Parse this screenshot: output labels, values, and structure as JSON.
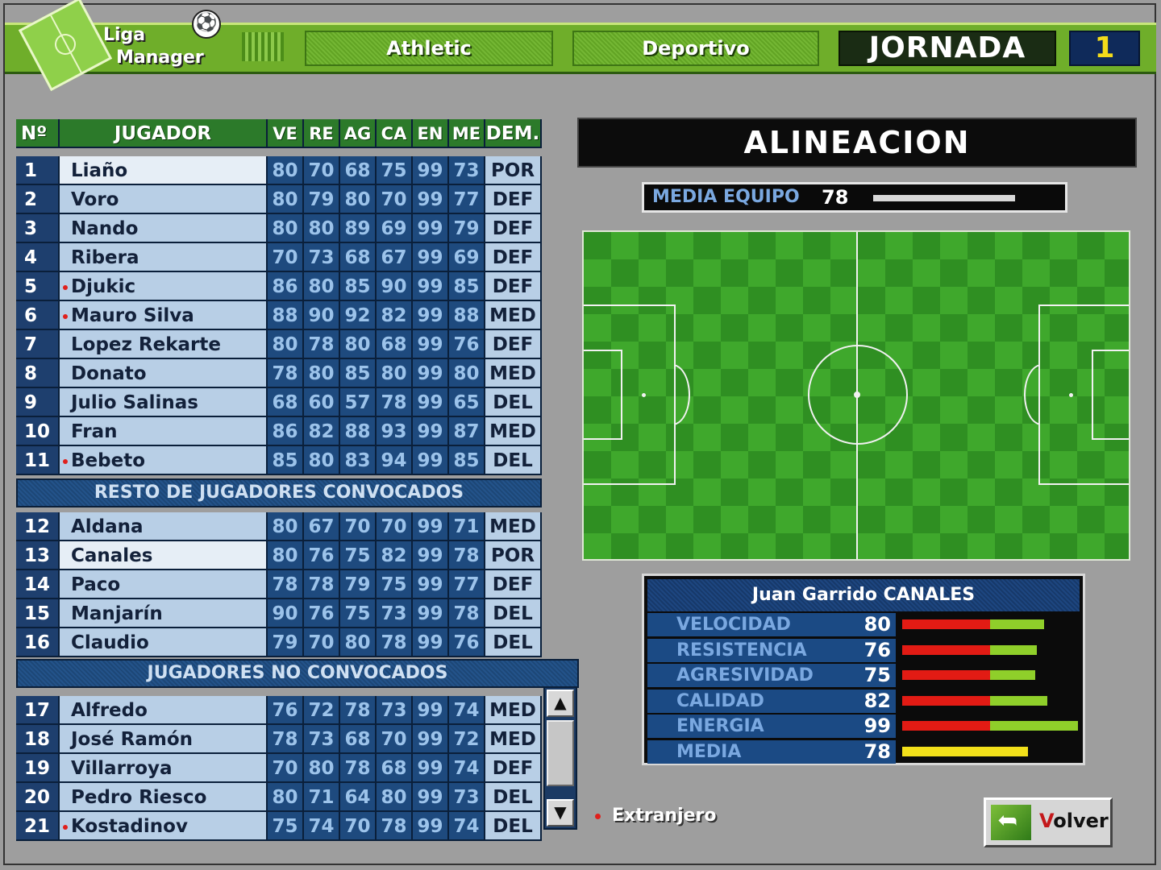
{
  "header": {
    "logo_line1": "Liga",
    "logo_line2": "Manager",
    "home_team": "Athletic",
    "away_team": "Deportivo",
    "jornada_label": "JORNADA",
    "jornada_number": "1"
  },
  "table": {
    "columns": [
      "Nº",
      "JUGADOR",
      "VE",
      "RE",
      "AG",
      "CA",
      "EN",
      "ME",
      "DEM."
    ],
    "starters": [
      {
        "num": "1",
        "name": "Liaño",
        "foreign": false,
        "highlight": true,
        "stats": [
          "80",
          "70",
          "68",
          "75",
          "99",
          "73"
        ],
        "pos": "POR"
      },
      {
        "num": "2",
        "name": "Voro",
        "foreign": false,
        "highlight": false,
        "stats": [
          "80",
          "79",
          "80",
          "70",
          "99",
          "77"
        ],
        "pos": "DEF"
      },
      {
        "num": "3",
        "name": "Nando",
        "foreign": false,
        "highlight": false,
        "stats": [
          "80",
          "80",
          "89",
          "69",
          "99",
          "79"
        ],
        "pos": "DEF"
      },
      {
        "num": "4",
        "name": "Ribera",
        "foreign": false,
        "highlight": false,
        "stats": [
          "70",
          "73",
          "68",
          "67",
          "99",
          "69"
        ],
        "pos": "DEF"
      },
      {
        "num": "5",
        "name": "Djukic",
        "foreign": true,
        "highlight": false,
        "stats": [
          "86",
          "80",
          "85",
          "90",
          "99",
          "85"
        ],
        "pos": "DEF"
      },
      {
        "num": "6",
        "name": "Mauro Silva",
        "foreign": true,
        "highlight": false,
        "stats": [
          "88",
          "90",
          "92",
          "82",
          "99",
          "88"
        ],
        "pos": "MED"
      },
      {
        "num": "7",
        "name": "Lopez Rekarte",
        "foreign": false,
        "highlight": false,
        "stats": [
          "80",
          "78",
          "80",
          "68",
          "99",
          "76"
        ],
        "pos": "DEF"
      },
      {
        "num": "8",
        "name": "Donato",
        "foreign": false,
        "highlight": false,
        "stats": [
          "78",
          "80",
          "85",
          "80",
          "99",
          "80"
        ],
        "pos": "MED"
      },
      {
        "num": "9",
        "name": "Julio Salinas",
        "foreign": false,
        "highlight": false,
        "stats": [
          "68",
          "60",
          "57",
          "78",
          "99",
          "65"
        ],
        "pos": "DEL"
      },
      {
        "num": "10",
        "name": "Fran",
        "foreign": false,
        "highlight": false,
        "stats": [
          "86",
          "82",
          "88",
          "93",
          "99",
          "87"
        ],
        "pos": "MED"
      },
      {
        "num": "11",
        "name": "Bebeto",
        "foreign": true,
        "highlight": false,
        "stats": [
          "85",
          "80",
          "83",
          "94",
          "99",
          "85"
        ],
        "pos": "DEL"
      }
    ],
    "convocados_title": "RESTO DE JUGADORES CONVOCADOS",
    "convocados": [
      {
        "num": "12",
        "name": "Aldana",
        "foreign": false,
        "highlight": false,
        "stats": [
          "80",
          "67",
          "70",
          "70",
          "99",
          "71"
        ],
        "pos": "MED"
      },
      {
        "num": "13",
        "name": "Canales",
        "foreign": false,
        "highlight": true,
        "stats": [
          "80",
          "76",
          "75",
          "82",
          "99",
          "78"
        ],
        "pos": "POR"
      },
      {
        "num": "14",
        "name": "Paco",
        "foreign": false,
        "highlight": false,
        "stats": [
          "78",
          "78",
          "79",
          "75",
          "99",
          "77"
        ],
        "pos": "DEF"
      },
      {
        "num": "15",
        "name": "Manjarín",
        "foreign": false,
        "highlight": false,
        "stats": [
          "90",
          "76",
          "75",
          "73",
          "99",
          "78"
        ],
        "pos": "DEL"
      },
      {
        "num": "16",
        "name": "Claudio",
        "foreign": false,
        "highlight": false,
        "stats": [
          "79",
          "70",
          "80",
          "78",
          "99",
          "76"
        ],
        "pos": "DEL"
      }
    ],
    "no_convocados_title": "JUGADORES NO CONVOCADOS",
    "no_convocados": [
      {
        "num": "17",
        "name": "Alfredo",
        "foreign": false,
        "highlight": false,
        "stats": [
          "76",
          "72",
          "78",
          "73",
          "99",
          "74"
        ],
        "pos": "MED"
      },
      {
        "num": "18",
        "name": "José Ramón",
        "foreign": false,
        "highlight": false,
        "stats": [
          "78",
          "73",
          "68",
          "70",
          "99",
          "72"
        ],
        "pos": "MED"
      },
      {
        "num": "19",
        "name": "Villarroya",
        "foreign": false,
        "highlight": false,
        "stats": [
          "70",
          "80",
          "78",
          "68",
          "99",
          "74"
        ],
        "pos": "DEF"
      },
      {
        "num": "20",
        "name": "Pedro Riesco",
        "foreign": false,
        "highlight": false,
        "stats": [
          "80",
          "71",
          "64",
          "80",
          "99",
          "73"
        ],
        "pos": "DEL"
      },
      {
        "num": "21",
        "name": "Kostadinov",
        "foreign": true,
        "highlight": false,
        "stats": [
          "75",
          "74",
          "70",
          "78",
          "99",
          "74"
        ],
        "pos": "DEL"
      }
    ]
  },
  "legend": {
    "foreign_label": "Extranjero"
  },
  "alineacion": {
    "title": "ALINEACION",
    "media_equipo_label": "MEDIA EQUIPO",
    "media_equipo_value": "78",
    "media_equipo_fraction": 0.78
  },
  "player_detail": {
    "name": "Juan Garrido CANALES",
    "attributes": [
      {
        "label": "VELOCIDAD",
        "value": "80",
        "red_fraction": 0.55,
        "total_fraction": 0.8,
        "color": "red-green"
      },
      {
        "label": "RESISTENCIA",
        "value": "76",
        "red_fraction": 0.55,
        "total_fraction": 0.76,
        "color": "red-green"
      },
      {
        "label": "AGRESIVIDAD",
        "value": "75",
        "red_fraction": 0.55,
        "total_fraction": 0.75,
        "color": "red-green"
      },
      {
        "label": "CALIDAD",
        "value": "82",
        "red_fraction": 0.55,
        "total_fraction": 0.82,
        "color": "red-green"
      },
      {
        "label": "ENERGIA",
        "value": "99",
        "red_fraction": 0.55,
        "total_fraction": 0.99,
        "color": "red-green"
      },
      {
        "label": "MEDIA",
        "value": "78",
        "red_fraction": 0,
        "total_fraction": 0.78,
        "color": "yellow"
      }
    ]
  },
  "buttons": {
    "volver_initial": "V",
    "volver_rest": "olver"
  },
  "icons": {
    "scroll_up": "▲",
    "scroll_down": "▼",
    "ball": "⚽"
  },
  "colors": {
    "pitch": "#2f8f22",
    "header_green": "#6fae2a",
    "foreign_dot": "#e0201c"
  }
}
